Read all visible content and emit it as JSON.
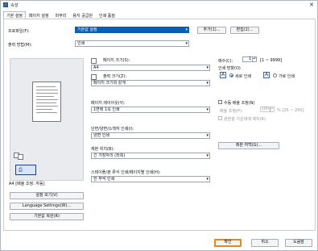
{
  "window": {
    "title": "속성",
    "close_glyph": "✕"
  },
  "tabs": [
    "기본 설정",
    "페이지 설정",
    "마무리",
    "용지 공급원",
    "인쇄 품질"
  ],
  "profile": {
    "label": "프로파일(F):",
    "value": "기본값 설정",
    "add": "추가(1)...",
    "edit": "편집(2)..."
  },
  "output": {
    "label": "출력 방법(M):",
    "value": "인쇄"
  },
  "preview": {
    "caption": "A4 [배율 조정: 자동]",
    "icon_glyph": "⎙"
  },
  "page_size": {
    "label": "페이지 크기(S):",
    "value": "A4"
  },
  "output_size": {
    "label": "출력 크기(Z):",
    "value": "페이지 크기와 같게"
  },
  "copies": {
    "label": "매수(C):",
    "value": "1",
    "range": "[1 ~ 9999]"
  },
  "orientation": {
    "label": "인쇄 방향(O)",
    "portrait": "세로 인쇄",
    "landscape": "가로 인쇄"
  },
  "layout": {
    "label": "페이지 레이아웃(Y):",
    "value": "1면에 1쪽 인쇄"
  },
  "manual_scale": {
    "label": "수동 배율 조정(N)",
    "scale_label": "배율 조정(P):",
    "value": "100",
    "range": "% [25 ~ 200]"
  },
  "watermark": {
    "label": "워터마크(W)",
    "disabled_label": "원본을 가운데에 배치(R)"
  },
  "duplex": {
    "label": "단면/양면/소책자 인쇄(I):",
    "value": "양면 인쇄"
  },
  "binding": {
    "label": "제본 위치(B):",
    "value": "긴 가장자리 (좌측)",
    "button": "제본 여백(G)..."
  },
  "staple": {
    "label": "스테이플/분 류식 인쇄/페이지별 인쇄(H):",
    "value": "한 부씩 인쇄"
  },
  "left_buttons": {
    "view_settings": "설정 보기(V)",
    "language": "Language Settings(W)...",
    "restore": "기본값 복원(R)"
  },
  "footer": {
    "ok": "확인",
    "cancel": "취소",
    "help": "도움말"
  }
}
